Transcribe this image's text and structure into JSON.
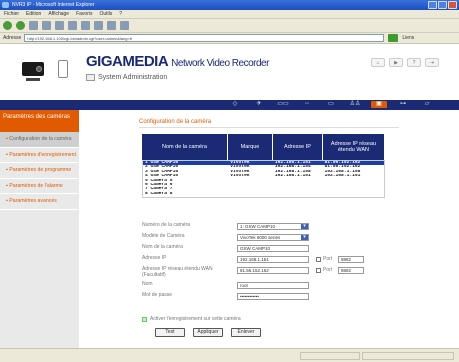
{
  "browser": {
    "title": "NVR3 IP - Microsoft Internet Explorer",
    "menu": [
      "Fichier",
      "Edition",
      "Affichage",
      "Favoris",
      "Outils",
      "?"
    ],
    "address_label": "Adresse",
    "url": "http://192.168.1.100/cgi-bin/admin.cgi?user=admin&lang=fr",
    "links_label": "Liens"
  },
  "header": {
    "brand": "GIGAMEDIA",
    "product": "Network Video Recorder",
    "subtitle": "System Administration"
  },
  "nav": {
    "icons": [
      "camera-icon",
      "network-icon",
      "record-icon",
      "connection-icon",
      "display-icon",
      "user-icon",
      "ip-camera-icon",
      "link-icon",
      "monitor-icon"
    ],
    "active_index": 6
  },
  "sidebar": {
    "header": "Paramètres des caméras",
    "items": [
      {
        "label": "Configuration de la caméra",
        "selected": true
      },
      {
        "label": "Paramètres d'enregistrement",
        "selected": false
      },
      {
        "label": "Paramètres de programme",
        "selected": false
      },
      {
        "label": "Paramètres de l'alarme",
        "selected": false
      },
      {
        "label": "Paramètres avancés",
        "selected": false
      }
    ]
  },
  "content": {
    "section_title": "Configuration de la caméra",
    "table": {
      "columns": [
        "Nom de la caméra",
        "Marque",
        "Adresse IP",
        "Adresse IP réseau étendu WAN"
      ],
      "rows": [
        [
          "1  GSW CAMP10",
          "Vivotek",
          "192.168.1.151",
          "81.56.152.162"
        ],
        [
          "2  GSW CAMP16",
          "Vivotek",
          "192.168.1.154",
          "81.56.152.162"
        ],
        [
          "3  GSW CAMP16",
          "Vivotek",
          "192.168.1.158",
          "192.168.1.158"
        ],
        [
          "4  GSW CAMP10",
          "Vivotek",
          "192.168.1.151",
          "192.168.1.151"
        ],
        [
          "5  Camera 5",
          "",
          "",
          ""
        ],
        [
          "6  Camera 6",
          "",
          "",
          ""
        ],
        [
          "7  Camera 7",
          "",
          "",
          ""
        ],
        [
          "8  Camera 8",
          "",
          "",
          ""
        ]
      ],
      "selected_row": 0
    },
    "form": {
      "camera_number_label": "Numéro de la caméra",
      "camera_number_value": "1: GSW CAMP10",
      "camera_model_label": "Modèle de Caméra",
      "camera_model_value": "VivoTek 6000 series",
      "camera_name_label": "Nom de la caméra",
      "camera_name_value": "GSW CAMP10",
      "ip_label": "Adresse IP",
      "ip_value": "192.168.1.151",
      "port_label": "Port",
      "port_value": "9882",
      "wan_ip_label": "Adresse IP réseau étendu WAN (Facultatif)",
      "wan_ip_value": "81.56.152.162",
      "wan_port_value": "9882",
      "user_label": "Nom",
      "user_value": "root",
      "password_label": "Mot de passe",
      "password_value": "••••••••••••",
      "archive_label": "Activer l'enregistrement sur cette caméra"
    },
    "buttons": {
      "test": "Test",
      "apply": "Appliquer",
      "delete": "Enlever"
    }
  }
}
